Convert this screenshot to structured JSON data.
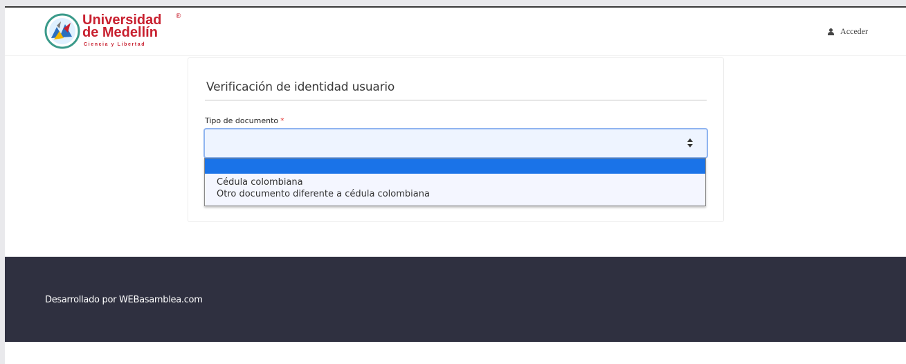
{
  "brand": {
    "name_line1": "Universidad",
    "name_line2": "de Medellín",
    "registered_mark": "®",
    "tagline": "Ciencia y Libertad",
    "color": "#c8202f"
  },
  "navbar": {
    "login_label": "Acceder",
    "login_icon": "user-icon"
  },
  "form": {
    "title": "Verificación de identidad usuario",
    "document_type": {
      "label": "Tipo de documento",
      "required_mark": "*",
      "value": "",
      "options": [
        "",
        "Cédula colombiana",
        "Otro documento diferente a cédula colombiana"
      ]
    }
  },
  "footer": {
    "text": "Desarrollado por WEBasamblea.com"
  },
  "colors": {
    "footer_bg": "#2f3040",
    "select_focus_border": "#8fb4f0",
    "option_highlight": "#1a73e8",
    "required": "#e53935"
  }
}
